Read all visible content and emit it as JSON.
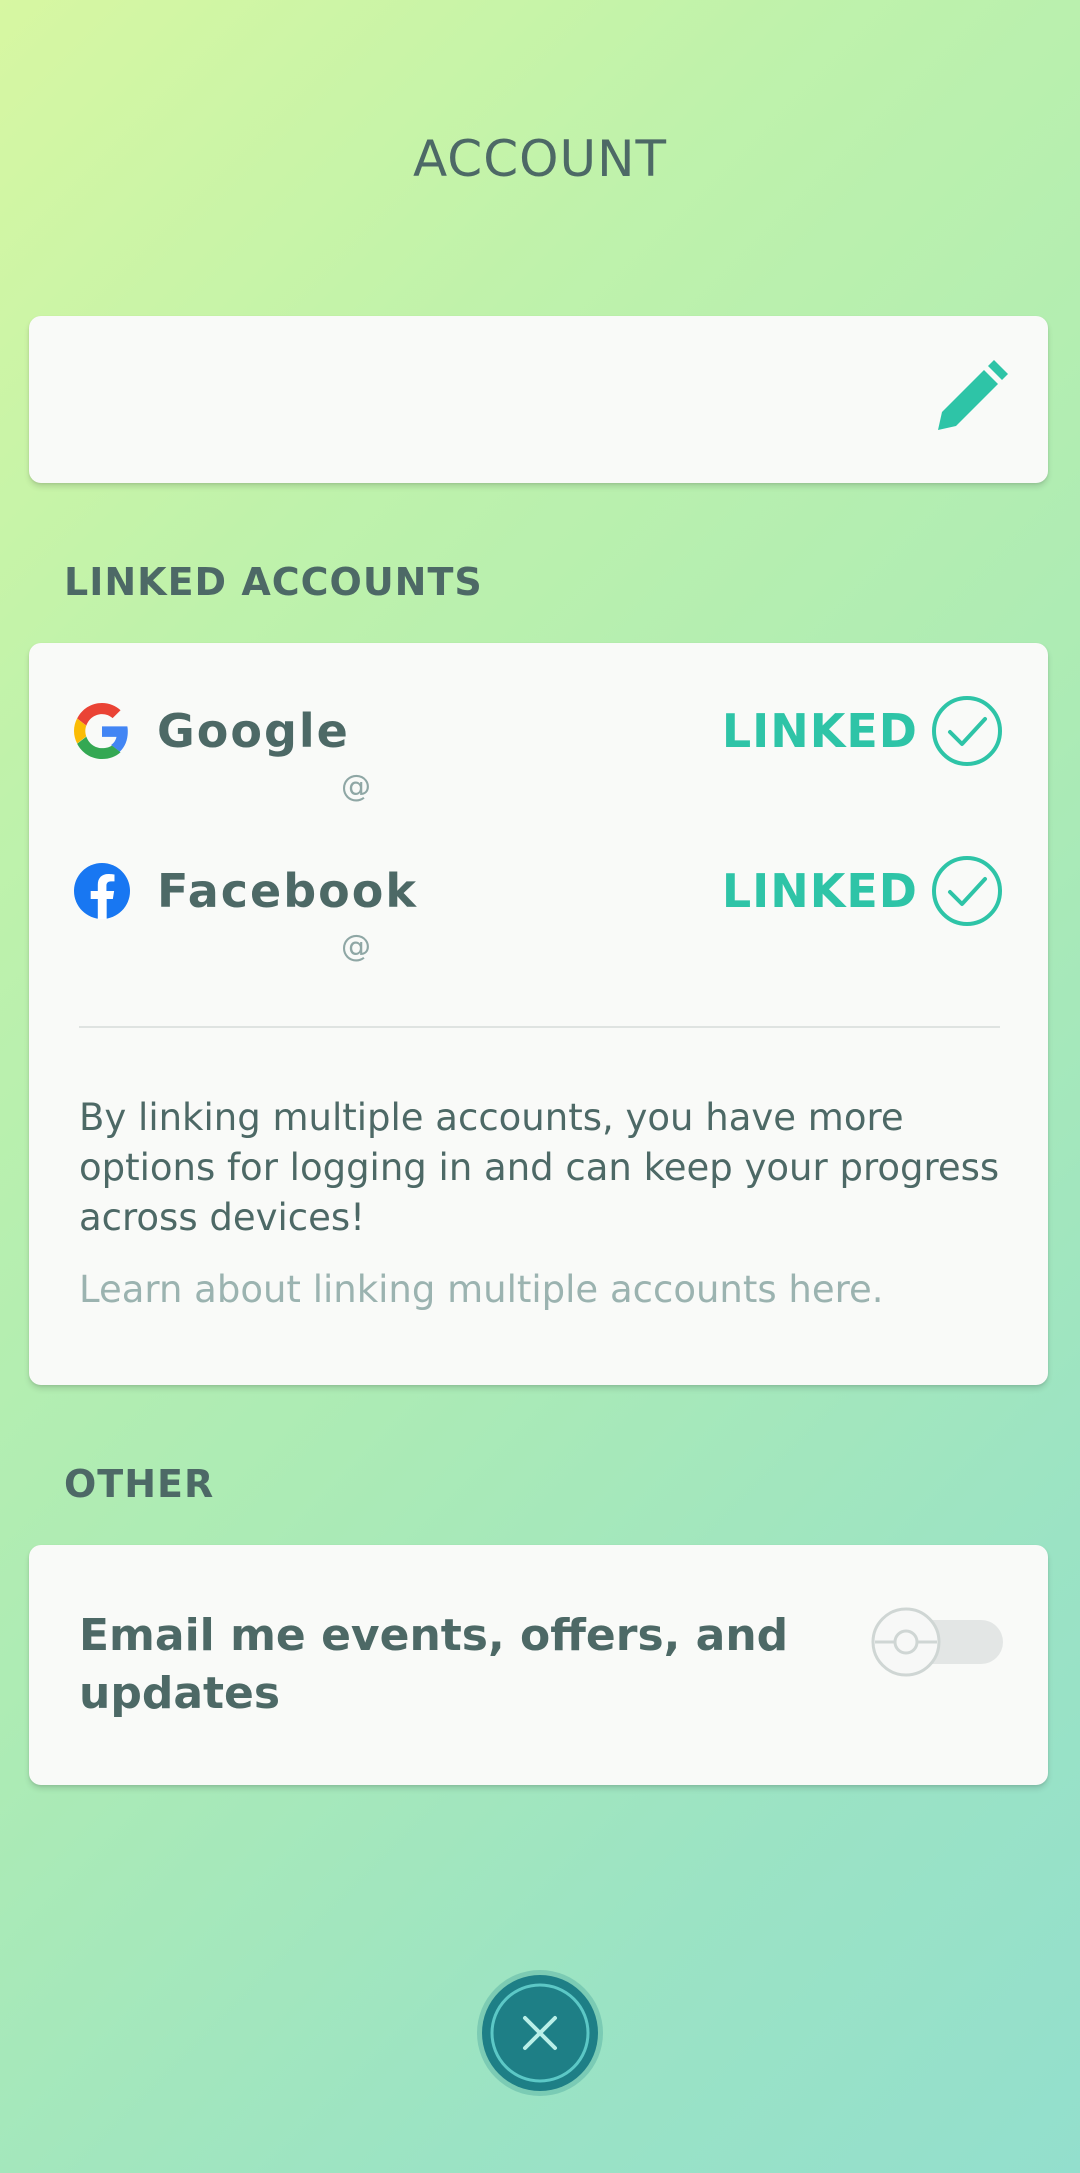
{
  "header": {
    "title": "ACCOUNT"
  },
  "name_card": {
    "edit_icon": "pencil-icon"
  },
  "linked_accounts": {
    "heading": "LINKED ACCOUNTS",
    "accounts": [
      {
        "name": "Google",
        "handle": "@",
        "status": "LINKED",
        "icon": "google-icon"
      },
      {
        "name": "Facebook",
        "handle": "@",
        "status": "LINKED",
        "icon": "facebook-icon"
      }
    ],
    "info": "By linking multiple accounts, you have more options for logging in and can keep your progress across devices!",
    "learn_link": "Learn about linking multiple accounts here."
  },
  "other": {
    "heading": "OTHER",
    "email_label": "Email me events, offers, and updates",
    "email_toggle_on": false
  },
  "close_icon": "close-icon",
  "colors": {
    "accent": "#2ec4a7",
    "text": "#4d6966",
    "muted": "#9bb3b0",
    "close_button": "#1e7f86"
  }
}
